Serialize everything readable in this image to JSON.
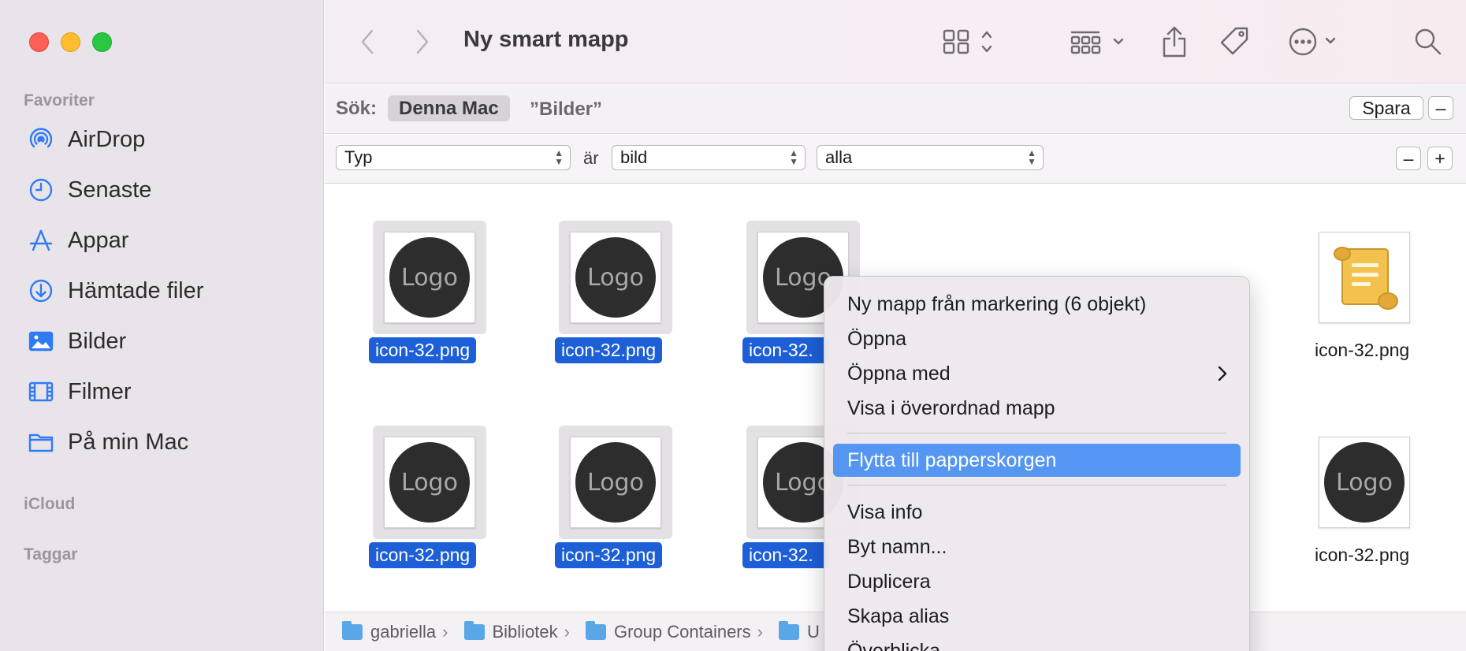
{
  "window": {
    "title": "Ny smart mapp"
  },
  "sidebar": {
    "favorites_header": "Favoriter",
    "items": [
      {
        "label": "AirDrop",
        "icon": "airdrop-icon"
      },
      {
        "label": "Senaste",
        "icon": "clock-icon"
      },
      {
        "label": "Appar",
        "icon": "apps-icon"
      },
      {
        "label": "Hämtade filer",
        "icon": "download-icon"
      },
      {
        "label": "Bilder",
        "icon": "photo-icon"
      },
      {
        "label": "Filmer",
        "icon": "film-icon"
      },
      {
        "label": "På min Mac",
        "icon": "folder-icon"
      }
    ],
    "icloud_header": "iCloud",
    "tags_header": "Taggar"
  },
  "search": {
    "label": "Sök:",
    "scope_active": "Denna Mac",
    "scope_other": "”Bilder”",
    "save_label": "Spara",
    "remove_label": "–"
  },
  "criteria": {
    "attribute": "Typ",
    "operator": "är",
    "value": "bild",
    "qualifier": "alla",
    "remove_label": "–",
    "add_label": "+"
  },
  "files": [
    {
      "name": "icon-32.png",
      "selected": true
    },
    {
      "name": "icon-32.png",
      "selected": true
    },
    {
      "name": "icon-32.",
      "selected": true
    },
    {
      "name": "icon-32.png",
      "selected": false
    },
    {
      "name": "icon-32.png",
      "selected": true
    },
    {
      "name": "icon-32.png",
      "selected": true
    },
    {
      "name": "icon-32.",
      "selected": true
    },
    {
      "name": "icon-32.png",
      "selected": false
    }
  ],
  "thumb_text": "Logo",
  "pathbar": {
    "segments": [
      "gabriella",
      "Bibliotek",
      "Group Containers",
      "U"
    ]
  },
  "context_menu": {
    "items": [
      "Ny mapp från markering (6 objekt)",
      "Öppna",
      "Öppna med",
      "Visa i överordnad mapp",
      "Flytta till papperskorgen",
      "Visa info",
      "Byt namn...",
      "Duplicera",
      "Skapa alias",
      "Överblicka"
    ],
    "highlighted": "Flytta till papperskorgen"
  },
  "colors": {
    "selection": "#1d5fd6",
    "menu_highlight": "#5496f2",
    "sidebar_accent": "#2f7bf5"
  }
}
